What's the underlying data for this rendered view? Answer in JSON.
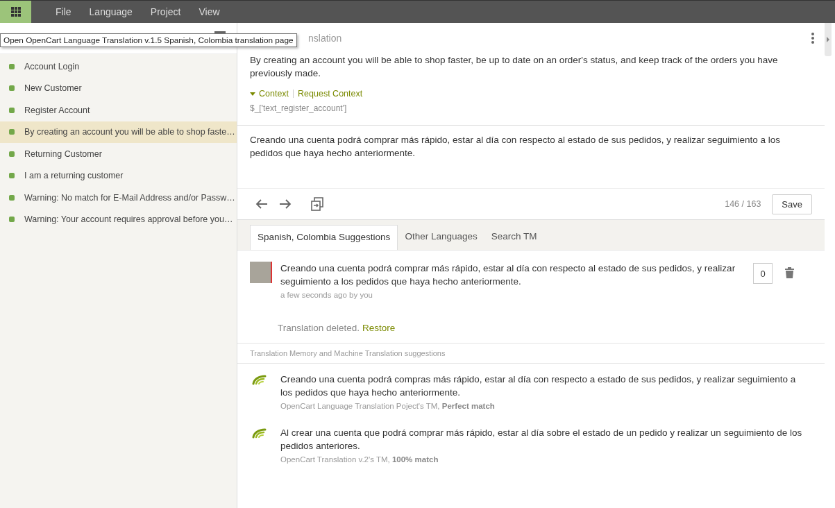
{
  "menu": {
    "items": [
      "File",
      "Language",
      "Project",
      "View"
    ]
  },
  "tooltip": "Open OpenCart Language Translation v.1.5 Spanish, Colombia translation page",
  "sidebar": {
    "items": [
      {
        "label": "Account Login",
        "selected": false
      },
      {
        "label": "New Customer",
        "selected": false
      },
      {
        "label": "Register Account",
        "selected": false
      },
      {
        "label": "By creating an account you will be able to shop faste…",
        "selected": true
      },
      {
        "label": "Returning Customer",
        "selected": false
      },
      {
        "label": "I am a returning customer",
        "selected": false
      },
      {
        "label": "Warning: No match for E-Mail Address and/or Passw…",
        "selected": false
      },
      {
        "label": "Warning: Your account requires approval before you…",
        "selected": false
      }
    ]
  },
  "editor": {
    "heading": "nslation",
    "source": "By creating an account you will be able to shop faster, be up to date on an order's status, and keep track of the orders you have previously made.",
    "context_toggle": "Context",
    "context_expanded": true,
    "request_context": "Request Context",
    "key": "$_['text_register_account']",
    "translation": "Creando una cuenta podrá comprar más rápido, estar al día con respecto al estado de sus pedidos, y realizar seguimiento a los pedidos que haya hecho anteriormente.",
    "counter": "146 / 163",
    "save": "Save"
  },
  "tabs": [
    {
      "label": "Spanish, Colombia Suggestions",
      "selected": true
    },
    {
      "label": "Other Languages",
      "selected": false
    },
    {
      "label": "Search TM",
      "selected": false
    }
  ],
  "suggestions": [
    {
      "text": "Creando una cuenta podrá comprar más rápido, estar al día con respecto al estado de sus pedidos, y realizar seguimiento a los pedidos que haya hecho anteriormente.",
      "meta": "a few seconds ago by you",
      "votes": "0"
    }
  ],
  "deleted_notice": {
    "text": "Translation deleted.",
    "action": "Restore"
  },
  "tm_heading": "Translation Memory and Machine Translation suggestions",
  "tm_suggestions": [
    {
      "text": "Creando una cuenta podrá compras más rápido, estar al día con respecto a estado de sus pedidos, y realizar seguimiento a los pedidos que haya hecho anteriormente.",
      "source": "OpenCart Language Translation Poject's TM, **Perfect match**"
    },
    {
      "text": "Al crear una cuenta que podrá comprar más rápido, estar al día sobre el estado de un pedido y realizar un seguimiento de los pedidos anteriores.",
      "source": "OpenCart Translation v.2's TM, **100% match**"
    }
  ]
}
